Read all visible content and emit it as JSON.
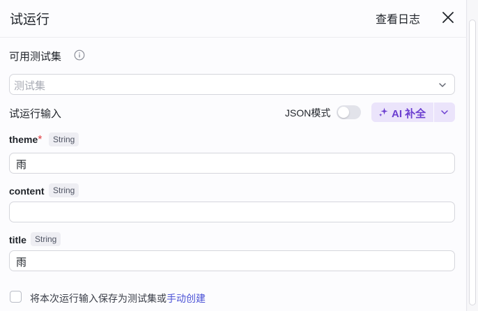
{
  "header": {
    "title": "试运行",
    "view_log": "查看日志"
  },
  "test_set": {
    "label": "可用测试集",
    "placeholder": "测试集"
  },
  "run_input": {
    "label": "试运行输入",
    "json_mode_label": "JSON模式",
    "json_mode_on": false,
    "ai_button_label": "AI 补全"
  },
  "fields": [
    {
      "name": "theme",
      "required": true,
      "type": "String",
      "value": "雨"
    },
    {
      "name": "content",
      "required": false,
      "type": "String",
      "value": ""
    },
    {
      "name": "title",
      "required": false,
      "type": "String",
      "value": "雨"
    }
  ],
  "footer": {
    "save_text": "将本次运行输入保存为测试集或",
    "manual_link": "手动创建",
    "checked": false
  },
  "colors": {
    "accent": "#6b3ed0",
    "link": "#4b52d6",
    "required": "#e0393e"
  }
}
